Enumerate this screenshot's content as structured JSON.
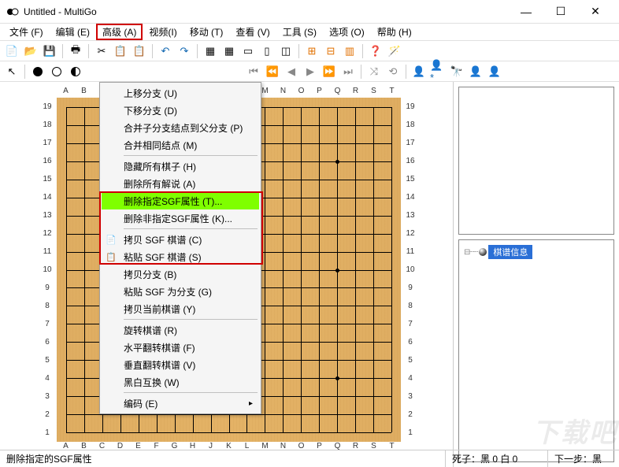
{
  "title": "Untitled - MultiGo",
  "menubar": [
    "文件 (F)",
    "编辑 (E)",
    "高级 (A)",
    "视频(I)",
    "移动 (T)",
    "查看 (V)",
    "工具 (S)",
    "选项 (O)",
    "帮助 (H)"
  ],
  "hl_menu_index": 2,
  "dropdown": {
    "items": [
      {
        "label": "上移分支 (U)",
        "icon": ""
      },
      {
        "label": "下移分支 (D)",
        "icon": ""
      },
      {
        "label": "合并子分支结点到父分支 (P)",
        "icon": ""
      },
      {
        "label": "合并相同结点 (M)",
        "icon": ""
      },
      {
        "sep": true
      },
      {
        "label": "隐藏所有棋子 (H)",
        "icon": ""
      },
      {
        "label": "删除所有解说 (A)",
        "icon": ""
      },
      {
        "label": "删除指定SGF属性 (T)...",
        "icon": "",
        "hl": true
      },
      {
        "label": "删除非指定SGF属性 (K)...",
        "icon": ""
      },
      {
        "sep": true
      },
      {
        "label": "拷贝 SGF 棋谱 (C)",
        "icon": "📄"
      },
      {
        "label": "粘贴 SGF 棋谱 (S)",
        "icon": "📋"
      },
      {
        "label": "拷贝分支 (B)",
        "icon": ""
      },
      {
        "label": "粘贴 SGF 为分支 (G)",
        "icon": ""
      },
      {
        "label": "拷贝当前棋谱 (Y)",
        "icon": ""
      },
      {
        "sep": true
      },
      {
        "label": "旋转棋谱 (R)",
        "icon": ""
      },
      {
        "label": "水平翻转棋谱 (F)",
        "icon": ""
      },
      {
        "label": "垂直翻转棋谱 (V)",
        "icon": ""
      },
      {
        "label": "黑白互换 (W)",
        "icon": ""
      },
      {
        "sep": true
      },
      {
        "label": "编码 (E)",
        "icon": "",
        "arrow": true
      }
    ]
  },
  "board": {
    "cols": [
      "A",
      "B",
      "C",
      "D",
      "E",
      "F",
      "G",
      "H",
      "J",
      "K",
      "L",
      "M",
      "N",
      "O",
      "P",
      "Q",
      "R",
      "S",
      "T"
    ],
    "rows": [
      19,
      18,
      17,
      16,
      15,
      14,
      13,
      12,
      11,
      10,
      9,
      8,
      7,
      6,
      5,
      4,
      3,
      2,
      1
    ],
    "stars": [
      [
        3,
        3
      ],
      [
        3,
        9
      ],
      [
        3,
        15
      ],
      [
        9,
        3
      ],
      [
        9,
        9
      ],
      [
        9,
        15
      ],
      [
        15,
        3
      ],
      [
        15,
        9
      ],
      [
        15,
        15
      ]
    ]
  },
  "tree": {
    "label": "棋谱信息"
  },
  "status": {
    "main": "删除指定的SGF属性",
    "capt": "死子：黑 0 白 0",
    "next": "下一步：黑"
  },
  "watermark": "下载吧"
}
